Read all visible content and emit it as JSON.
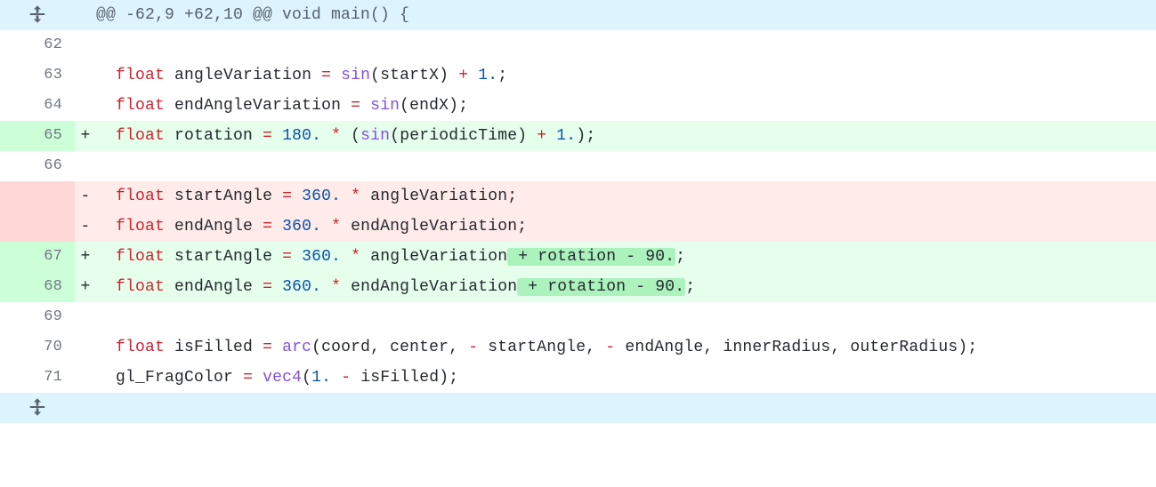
{
  "hunk_header": "@@ -62,9 +62,10 @@ void main() {",
  "lines": [
    {
      "type": "ctx",
      "old": "",
      "new": "62",
      "tokens": []
    },
    {
      "type": "ctx",
      "old": "",
      "new": "63",
      "tokens": [
        {
          "t": "  ",
          "c": "id"
        },
        {
          "t": "float",
          "c": "kw"
        },
        {
          "t": " ",
          "c": "id"
        },
        {
          "t": "angleVariation",
          "c": "id"
        },
        {
          "t": " ",
          "c": "id"
        },
        {
          "t": "=",
          "c": "op"
        },
        {
          "t": " ",
          "c": "id"
        },
        {
          "t": "sin",
          "c": "fn"
        },
        {
          "t": "(",
          "c": "punc"
        },
        {
          "t": "startX",
          "c": "id"
        },
        {
          "t": ")",
          "c": "punc"
        },
        {
          "t": " ",
          "c": "id"
        },
        {
          "t": "+",
          "c": "op"
        },
        {
          "t": " ",
          "c": "id"
        },
        {
          "t": "1.",
          "c": "num"
        },
        {
          "t": ";",
          "c": "punc"
        }
      ]
    },
    {
      "type": "ctx",
      "old": "",
      "new": "64",
      "tokens": [
        {
          "t": "  ",
          "c": "id"
        },
        {
          "t": "float",
          "c": "kw"
        },
        {
          "t": " ",
          "c": "id"
        },
        {
          "t": "endAngleVariation",
          "c": "id"
        },
        {
          "t": " ",
          "c": "id"
        },
        {
          "t": "=",
          "c": "op"
        },
        {
          "t": " ",
          "c": "id"
        },
        {
          "t": "sin",
          "c": "fn"
        },
        {
          "t": "(",
          "c": "punc"
        },
        {
          "t": "endX",
          "c": "id"
        },
        {
          "t": ")",
          "c": "punc"
        },
        {
          "t": ";",
          "c": "punc"
        }
      ]
    },
    {
      "type": "add",
      "old": "",
      "new": "65",
      "tokens": [
        {
          "t": "  ",
          "c": "id"
        },
        {
          "t": "float",
          "c": "kw"
        },
        {
          "t": " ",
          "c": "id"
        },
        {
          "t": "rotation",
          "c": "id"
        },
        {
          "t": " ",
          "c": "id"
        },
        {
          "t": "=",
          "c": "op"
        },
        {
          "t": " ",
          "c": "id"
        },
        {
          "t": "180.",
          "c": "num"
        },
        {
          "t": " ",
          "c": "id"
        },
        {
          "t": "*",
          "c": "op"
        },
        {
          "t": " (",
          "c": "punc"
        },
        {
          "t": "sin",
          "c": "fn"
        },
        {
          "t": "(",
          "c": "punc"
        },
        {
          "t": "periodicTime",
          "c": "id"
        },
        {
          "t": ")",
          "c": "punc"
        },
        {
          "t": " ",
          "c": "id"
        },
        {
          "t": "+",
          "c": "op"
        },
        {
          "t": " ",
          "c": "id"
        },
        {
          "t": "1.",
          "c": "num"
        },
        {
          "t": ");",
          "c": "punc"
        }
      ]
    },
    {
      "type": "ctx",
      "old": "",
      "new": "66",
      "tokens": []
    },
    {
      "type": "del",
      "old": "",
      "new": "",
      "tokens": [
        {
          "t": "  ",
          "c": "id"
        },
        {
          "t": "float",
          "c": "kw"
        },
        {
          "t": " ",
          "c": "id"
        },
        {
          "t": "startAngle",
          "c": "id"
        },
        {
          "t": " ",
          "c": "id"
        },
        {
          "t": "=",
          "c": "op"
        },
        {
          "t": " ",
          "c": "id"
        },
        {
          "t": "360.",
          "c": "num"
        },
        {
          "t": " ",
          "c": "id"
        },
        {
          "t": "*",
          "c": "op"
        },
        {
          "t": " ",
          "c": "id"
        },
        {
          "t": "angleVariation",
          "c": "id"
        },
        {
          "t": ";",
          "c": "punc"
        }
      ]
    },
    {
      "type": "del",
      "old": "",
      "new": "",
      "tokens": [
        {
          "t": "  ",
          "c": "id"
        },
        {
          "t": "float",
          "c": "kw"
        },
        {
          "t": " ",
          "c": "id"
        },
        {
          "t": "endAngle",
          "c": "id"
        },
        {
          "t": " ",
          "c": "id"
        },
        {
          "t": "=",
          "c": "op"
        },
        {
          "t": " ",
          "c": "id"
        },
        {
          "t": "360.",
          "c": "num"
        },
        {
          "t": " ",
          "c": "id"
        },
        {
          "t": "*",
          "c": "op"
        },
        {
          "t": " ",
          "c": "id"
        },
        {
          "t": "endAngleVariation",
          "c": "id"
        },
        {
          "t": ";",
          "c": "punc"
        }
      ]
    },
    {
      "type": "add",
      "old": "",
      "new": "67",
      "tokens": [
        {
          "t": "  ",
          "c": "id"
        },
        {
          "t": "float",
          "c": "kw"
        },
        {
          "t": " ",
          "c": "id"
        },
        {
          "t": "startAngle",
          "c": "id"
        },
        {
          "t": " ",
          "c": "id"
        },
        {
          "t": "=",
          "c": "op"
        },
        {
          "t": " ",
          "c": "id"
        },
        {
          "t": "360.",
          "c": "num"
        },
        {
          "t": " ",
          "c": "id"
        },
        {
          "t": "*",
          "c": "op"
        },
        {
          "t": " ",
          "c": "id"
        },
        {
          "t": "angleVariation",
          "c": "id"
        },
        {
          "t": " + rotation - 90.",
          "c": "id",
          "hl": "add"
        },
        {
          "t": ";",
          "c": "punc"
        }
      ]
    },
    {
      "type": "add",
      "old": "",
      "new": "68",
      "tokens": [
        {
          "t": "  ",
          "c": "id"
        },
        {
          "t": "float",
          "c": "kw"
        },
        {
          "t": " ",
          "c": "id"
        },
        {
          "t": "endAngle",
          "c": "id"
        },
        {
          "t": " ",
          "c": "id"
        },
        {
          "t": "=",
          "c": "op"
        },
        {
          "t": " ",
          "c": "id"
        },
        {
          "t": "360.",
          "c": "num"
        },
        {
          "t": " ",
          "c": "id"
        },
        {
          "t": "*",
          "c": "op"
        },
        {
          "t": " ",
          "c": "id"
        },
        {
          "t": "endAngleVariation",
          "c": "id"
        },
        {
          "t": " + rotation - 90.",
          "c": "id",
          "hl": "add"
        },
        {
          "t": ";",
          "c": "punc"
        }
      ]
    },
    {
      "type": "ctx",
      "old": "",
      "new": "69",
      "tokens": []
    },
    {
      "type": "ctx",
      "old": "",
      "new": "70",
      "tokens": [
        {
          "t": "  ",
          "c": "id"
        },
        {
          "t": "float",
          "c": "kw"
        },
        {
          "t": " ",
          "c": "id"
        },
        {
          "t": "isFilled",
          "c": "id"
        },
        {
          "t": " ",
          "c": "id"
        },
        {
          "t": "=",
          "c": "op"
        },
        {
          "t": " ",
          "c": "id"
        },
        {
          "t": "arc",
          "c": "fn"
        },
        {
          "t": "(",
          "c": "punc"
        },
        {
          "t": "coord",
          "c": "id"
        },
        {
          "t": ", ",
          "c": "punc"
        },
        {
          "t": "center",
          "c": "id"
        },
        {
          "t": ", ",
          "c": "punc"
        },
        {
          "t": "-",
          "c": "op"
        },
        {
          "t": " ",
          "c": "id"
        },
        {
          "t": "startAngle",
          "c": "id"
        },
        {
          "t": ", ",
          "c": "punc"
        },
        {
          "t": "-",
          "c": "op"
        },
        {
          "t": " ",
          "c": "id"
        },
        {
          "t": "endAngle",
          "c": "id"
        },
        {
          "t": ", ",
          "c": "punc"
        },
        {
          "t": "innerRadius",
          "c": "id"
        },
        {
          "t": ", ",
          "c": "punc"
        },
        {
          "t": "outerRadius",
          "c": "id"
        },
        {
          "t": ");",
          "c": "punc"
        }
      ]
    },
    {
      "type": "ctx",
      "old": "",
      "new": "71",
      "tokens": [
        {
          "t": "  ",
          "c": "id"
        },
        {
          "t": "gl_FragColor",
          "c": "id"
        },
        {
          "t": " ",
          "c": "id"
        },
        {
          "t": "=",
          "c": "op"
        },
        {
          "t": " ",
          "c": "id"
        },
        {
          "t": "vec4",
          "c": "fn"
        },
        {
          "t": "(",
          "c": "punc"
        },
        {
          "t": "1.",
          "c": "num"
        },
        {
          "t": " ",
          "c": "id"
        },
        {
          "t": "-",
          "c": "op"
        },
        {
          "t": " ",
          "c": "id"
        },
        {
          "t": "isFilled",
          "c": "id"
        },
        {
          "t": ");",
          "c": "punc"
        }
      ]
    }
  ],
  "signs": {
    "add": "+",
    "del": "-",
    "ctx": " "
  }
}
